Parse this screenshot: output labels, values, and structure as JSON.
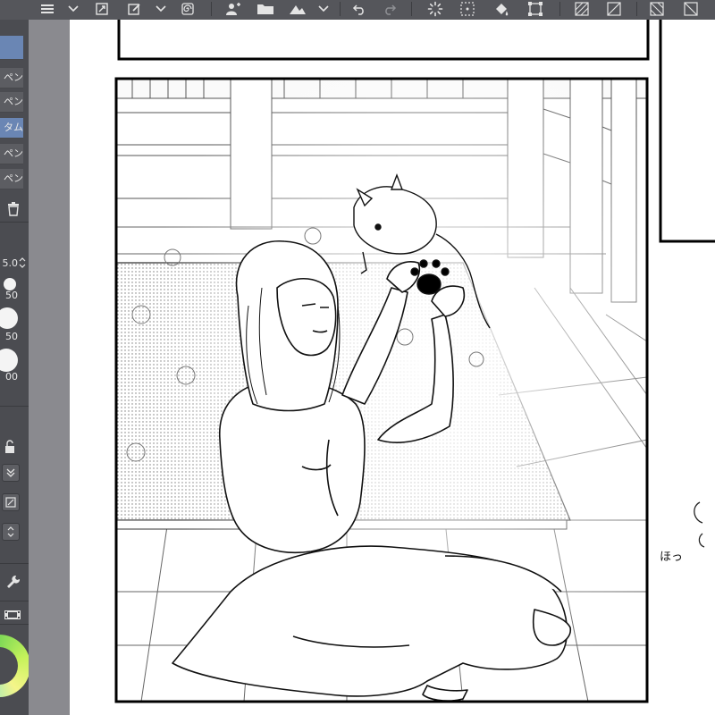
{
  "left_panel": {
    "subtools": [
      {
        "label": "ペン",
        "selected": false
      },
      {
        "label": "ペン",
        "selected": false
      },
      {
        "label": "タム",
        "selected": true
      },
      {
        "label": "ペン",
        "selected": false
      },
      {
        "label": "ペン",
        "selected": false
      }
    ],
    "brush_size_value": "5.0",
    "brush_presets": [
      "50",
      "50",
      "00"
    ]
  },
  "canvas": {
    "side_note_text": "ほっ",
    "chibi_thumb_icon": "paw-print-icon"
  },
  "icons": [
    "menu-icon",
    "dropdown-icon",
    "transform-icon",
    "edit-layer-icon",
    "spiral-icon",
    "add-user-icon",
    "open-folder-icon",
    "image-icon",
    "undo-icon",
    "redo-icon",
    "loading-spinner-icon",
    "dotted-grid-icon",
    "fill-icon",
    "selection-icon",
    "hatching-icon",
    "trash-icon",
    "lock-icon",
    "film-icon",
    "wrench-icon",
    "color-wheel-icon"
  ],
  "colors": {
    "toolbar": "#55565b",
    "panel": "#4b4c51",
    "selection": "#6a86b4",
    "canvas_gutter": "#8a8a8f",
    "color_wheel": "#7ed957"
  }
}
